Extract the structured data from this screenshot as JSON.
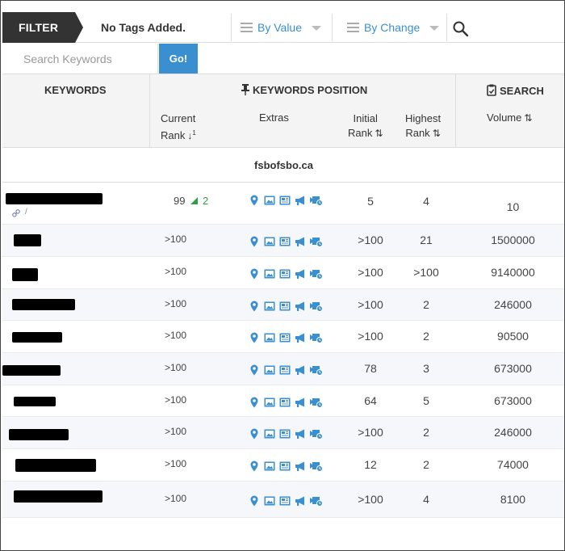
{
  "filter": {
    "label": "FILTER",
    "no_tags": "No Tags Added.",
    "by_value": "By Value",
    "by_change": "By Change"
  },
  "search": {
    "placeholder": "Search Keywords",
    "go_label": "Go!"
  },
  "headers": {
    "keywords": "KEYWORDS",
    "keywords_position": "KEYWORDS POSITION",
    "search": "SEARCH",
    "current": "Current",
    "current_rank": "Rank",
    "extras": "Extras",
    "initial": "Initial",
    "initial_rank": "Rank",
    "highest": "Highest",
    "highest_rank": "Rank",
    "volume": "Volume"
  },
  "domain": "fsbofsbo.ca",
  "rows": [
    {
      "current": "99",
      "change": "2",
      "initial": "5",
      "highest": "4",
      "volume": "10",
      "link_text": "/"
    },
    {
      "current": ">100",
      "initial": ">100",
      "highest": "21",
      "volume": "1500000"
    },
    {
      "current": ">100",
      "initial": ">100",
      "highest": ">100",
      "volume": "9140000"
    },
    {
      "current": ">100",
      "initial": ">100",
      "highest": "2",
      "volume": "246000"
    },
    {
      "current": ">100",
      "initial": ">100",
      "highest": "2",
      "volume": "90500"
    },
    {
      "current": ">100",
      "initial": "78",
      "highest": "3",
      "volume": "673000"
    },
    {
      "current": ">100",
      "initial": "64",
      "highest": "5",
      "volume": "673000"
    },
    {
      "current": ">100",
      "initial": ">100",
      "highest": "2",
      "volume": "246000"
    },
    {
      "current": ">100",
      "initial": "12",
      "highest": "2",
      "volume": "74000"
    },
    {
      "current": ">100",
      "initial": ">100",
      "highest": "4",
      "volume": "8100"
    }
  ],
  "extras_icons": [
    "map-pin-icon",
    "image-icon",
    "news-icon",
    "megaphone-icon",
    "video-icon"
  ],
  "colors": {
    "accent": "#3a8fd0",
    "dark": "#333333",
    "up": "#2ea043"
  }
}
